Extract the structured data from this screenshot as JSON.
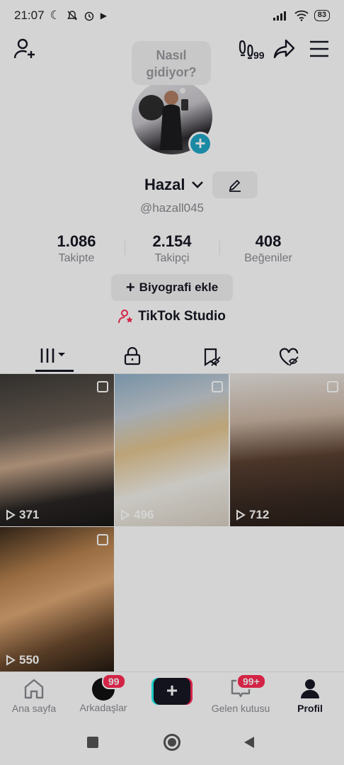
{
  "status_bar": {
    "time": "21:07",
    "battery": "83"
  },
  "tooltip": {
    "line1": "Nasıl",
    "line2": "gidiyor?"
  },
  "top_bar": {
    "footprint_badge": "99"
  },
  "profile": {
    "name": "Hazal",
    "handle": "@hazall045",
    "stats": [
      {
        "value": "1.086",
        "label": "Takipte"
      },
      {
        "value": "2.154",
        "label": "Takipçi"
      },
      {
        "value": "408",
        "label": "Beğeniler"
      }
    ],
    "bio_button": "Biyografi ekle",
    "studio_link": "TikTok Studio"
  },
  "videos": [
    {
      "views": "371"
    },
    {
      "views": "496"
    },
    {
      "views": "712"
    },
    {
      "views": "550"
    }
  ],
  "bottom_nav": {
    "home": "Ana sayfa",
    "friends": "Arkadaşlar",
    "friends_badge": "99",
    "inbox": "Gelen kutusu",
    "inbox_badge": "99+",
    "profile": "Profil"
  },
  "colors": {
    "accent": "#fe2c55",
    "teal": "#20a6c7",
    "text": "#161823",
    "muted": "#8a8b91"
  }
}
